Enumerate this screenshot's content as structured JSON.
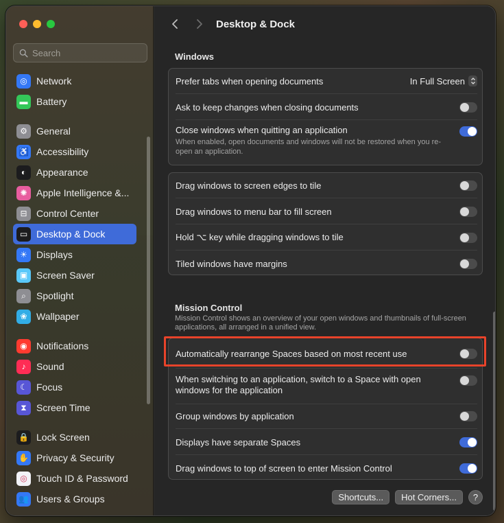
{
  "window": {
    "title": "Desktop & Dock"
  },
  "search": {
    "placeholder": "Search"
  },
  "sidebar": {
    "items": [
      {
        "label": "Network",
        "icon": "network-icon",
        "color": "#3478f6",
        "glyph": "◎"
      },
      {
        "label": "Battery",
        "icon": "battery-icon",
        "color": "#34c759",
        "glyph": "▬"
      },
      {
        "label": "General",
        "icon": "gear-icon",
        "color": "#8e8e93",
        "glyph": "⚙"
      },
      {
        "label": "Accessibility",
        "icon": "accessibility-icon",
        "color": "#3478f6",
        "glyph": "♿"
      },
      {
        "label": "Appearance",
        "icon": "appearance-icon",
        "color": "#1c1c1e",
        "glyph": "◐"
      },
      {
        "label": "Apple Intelligence &...",
        "icon": "apple-intelligence-icon",
        "color": "#e85d9f",
        "glyph": "✺"
      },
      {
        "label": "Control Center",
        "icon": "control-center-icon",
        "color": "#8e8e93",
        "glyph": "⊟"
      },
      {
        "label": "Desktop & Dock",
        "icon": "desktop-dock-icon",
        "color": "#1c1c1e",
        "glyph": "▭"
      },
      {
        "label": "Displays",
        "icon": "displays-icon",
        "color": "#3478f6",
        "glyph": "☀"
      },
      {
        "label": "Screen Saver",
        "icon": "screen-saver-icon",
        "color": "#5ac8fa",
        "glyph": "▣"
      },
      {
        "label": "Spotlight",
        "icon": "spotlight-icon",
        "color": "#8e8e93",
        "glyph": "⌕"
      },
      {
        "label": "Wallpaper",
        "icon": "wallpaper-icon",
        "color": "#32ade6",
        "glyph": "❀"
      },
      {
        "label": "Notifications",
        "icon": "notifications-icon",
        "color": "#ff3b30",
        "glyph": "◉"
      },
      {
        "label": "Sound",
        "icon": "sound-icon",
        "color": "#ff2d55",
        "glyph": "♪"
      },
      {
        "label": "Focus",
        "icon": "focus-icon",
        "color": "#5856d6",
        "glyph": "☾"
      },
      {
        "label": "Screen Time",
        "icon": "screen-time-icon",
        "color": "#5856d6",
        "glyph": "⧗"
      },
      {
        "label": "Lock Screen",
        "icon": "lock-icon",
        "color": "#1c1c1e",
        "glyph": "🔒"
      },
      {
        "label": "Privacy & Security",
        "icon": "privacy-hand-icon",
        "color": "#3478f6",
        "glyph": "✋"
      },
      {
        "label": "Touch ID & Password",
        "icon": "fingerprint-icon",
        "color": "#f2f2f7",
        "glyph": "◎"
      },
      {
        "label": "Users & Groups",
        "icon": "users-icon",
        "color": "#3478f6",
        "glyph": "👥"
      }
    ]
  },
  "windows_section": {
    "title": "Windows",
    "prefer_tabs": {
      "label": "Prefer tabs when opening documents",
      "value": "In Full Screen"
    },
    "ask_keep_changes": {
      "label": "Ask to keep changes when closing documents",
      "on": false
    },
    "close_windows": {
      "label": "Close windows when quitting an application",
      "sub": "When enabled, open documents and windows will not be restored when you re-open an application.",
      "on": true
    },
    "tiling": [
      {
        "label": "Drag windows to screen edges to tile",
        "on": false
      },
      {
        "label": "Drag windows to menu bar to fill screen",
        "on": false
      },
      {
        "label": "Hold ⌥ key while dragging windows to tile",
        "on": false
      },
      {
        "label": "Tiled windows have margins",
        "on": false
      }
    ]
  },
  "mission_control": {
    "title": "Mission Control",
    "description": "Mission Control shows an overview of your open windows and thumbnails of full-screen applications, all arranged in a unified view.",
    "rows": [
      {
        "label": "Automatically rearrange Spaces based on most recent use",
        "on": false
      },
      {
        "label": "When switching to an application, switch to a Space with open windows for the application",
        "on": false
      },
      {
        "label": "Group windows by application",
        "on": false
      },
      {
        "label": "Displays have separate Spaces",
        "on": true
      },
      {
        "label": "Drag windows to top of screen to enter Mission Control",
        "on": true
      }
    ]
  },
  "buttons": {
    "shortcuts": "Shortcuts...",
    "hot_corners": "Hot Corners...",
    "help": "?"
  },
  "colors": {
    "accent": "#3f6bd9",
    "highlight": "#e8432a"
  }
}
